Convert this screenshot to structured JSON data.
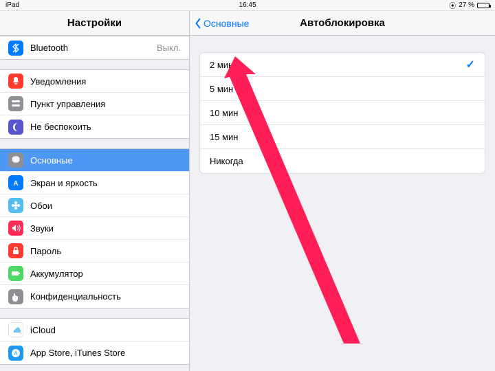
{
  "status": {
    "device": "iPad",
    "time": "16:45",
    "battery_pct": "27 %",
    "battery_fill": 27
  },
  "sidebar": {
    "title": "Настройки",
    "section1": [
      {
        "label": "Bluetooth",
        "value": "Выкл.",
        "icon": "bluetooth",
        "bg": "#007aff"
      }
    ],
    "section2": [
      {
        "label": "Уведомления",
        "icon": "bell",
        "bg": "#ff3b30"
      },
      {
        "label": "Пункт управления",
        "icon": "switches",
        "bg": "#8e8e93"
      },
      {
        "label": "Не беспокоить",
        "icon": "moon",
        "bg": "#5756ce"
      }
    ],
    "section3": [
      {
        "label": "Основные",
        "icon": "gear",
        "bg": "#8e8e93",
        "selected": true
      },
      {
        "label": "Экран и яркость",
        "icon": "aa",
        "bg": "#007aff"
      },
      {
        "label": "Обои",
        "icon": "flower",
        "bg": "#55bef0"
      },
      {
        "label": "Звуки",
        "icon": "speaker",
        "bg": "#ff2d55"
      },
      {
        "label": "Пароль",
        "icon": "lock",
        "bg": "#ff3b30"
      },
      {
        "label": "Аккумулятор",
        "icon": "battery",
        "bg": "#4cd964"
      },
      {
        "label": "Конфиденциальность",
        "icon": "hand",
        "bg": "#8e8e93"
      }
    ],
    "section4": [
      {
        "label": "iCloud",
        "icon": "cloud",
        "bg": "#ffffff"
      },
      {
        "label": "App Store, iTunes Store",
        "icon": "appstore",
        "bg": "#1e98f2"
      }
    ]
  },
  "detail": {
    "back": "Основные",
    "title": "Автоблокировка",
    "options": [
      {
        "label": "2 мин",
        "selected": true
      },
      {
        "label": "5 мин",
        "selected": false
      },
      {
        "label": "10 мин",
        "selected": false
      },
      {
        "label": "15 мин",
        "selected": false
      },
      {
        "label": "Никогда",
        "selected": false
      }
    ]
  }
}
